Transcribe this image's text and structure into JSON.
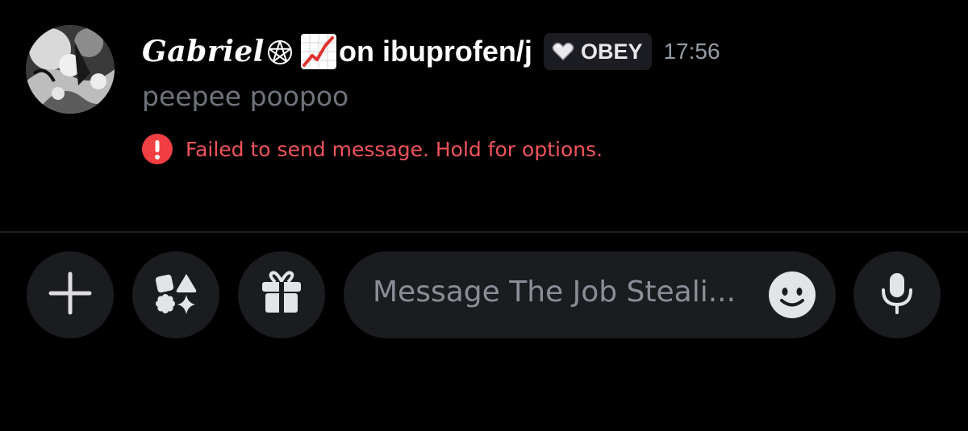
{
  "message": {
    "username": "Gabriel",
    "username_suffix": "on ibuprofen/j",
    "tag_label": "OBEY",
    "timestamp": "17:56",
    "content": "peepee poopoo",
    "error": "Failed to send message. Hold for options."
  },
  "composer": {
    "placeholder": "Message The Job Steali..."
  },
  "icons": {
    "avatar": "avatar-image",
    "username_decoration_1": "pentagram-icon",
    "username_decoration_2": "chart-increasing-icon",
    "tag_icon": "white-heart-icon",
    "error_icon": "alert-icon",
    "attach": "plus-icon",
    "apps": "apps-shapes-icon",
    "gift": "gift-icon",
    "emoji": "smiley-icon",
    "voice": "microphone-icon"
  },
  "colors": {
    "background": "#000000",
    "error": "#f2545b",
    "muted_text": "#6f737c",
    "button_bg": "#1b1c20"
  }
}
